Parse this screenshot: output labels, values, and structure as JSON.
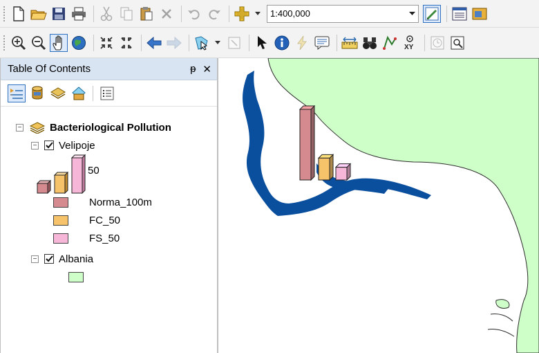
{
  "toolbar": {
    "scale_value": "1:400,000"
  },
  "toc": {
    "title": "Table Of Contents",
    "pin_glyph": "ᵽ",
    "close_glyph": "✕",
    "group": {
      "label": "Bacteriological Pollution",
      "layers": [
        {
          "label": "Velipoje",
          "checked": true,
          "chart_size_label": "50",
          "legend": [
            {
              "label": "Norma_100m",
              "color": "#d48a8f"
            },
            {
              "label": "FC_50",
              "color": "#f6c36b"
            },
            {
              "label": "FS_50",
              "color": "#f6b6d8"
            }
          ]
        },
        {
          "label": "Albania",
          "checked": true,
          "fill_color": "#cfffc8"
        }
      ]
    }
  },
  "map": {
    "land_color": "#cfffc8",
    "water_color": "#0a4e9e",
    "chart_values": [
      {
        "field": "Norma_100m",
        "value": 100
      },
      {
        "field": "FC_50",
        "value": 31
      },
      {
        "field": "FS_50",
        "value": 18
      }
    ]
  }
}
